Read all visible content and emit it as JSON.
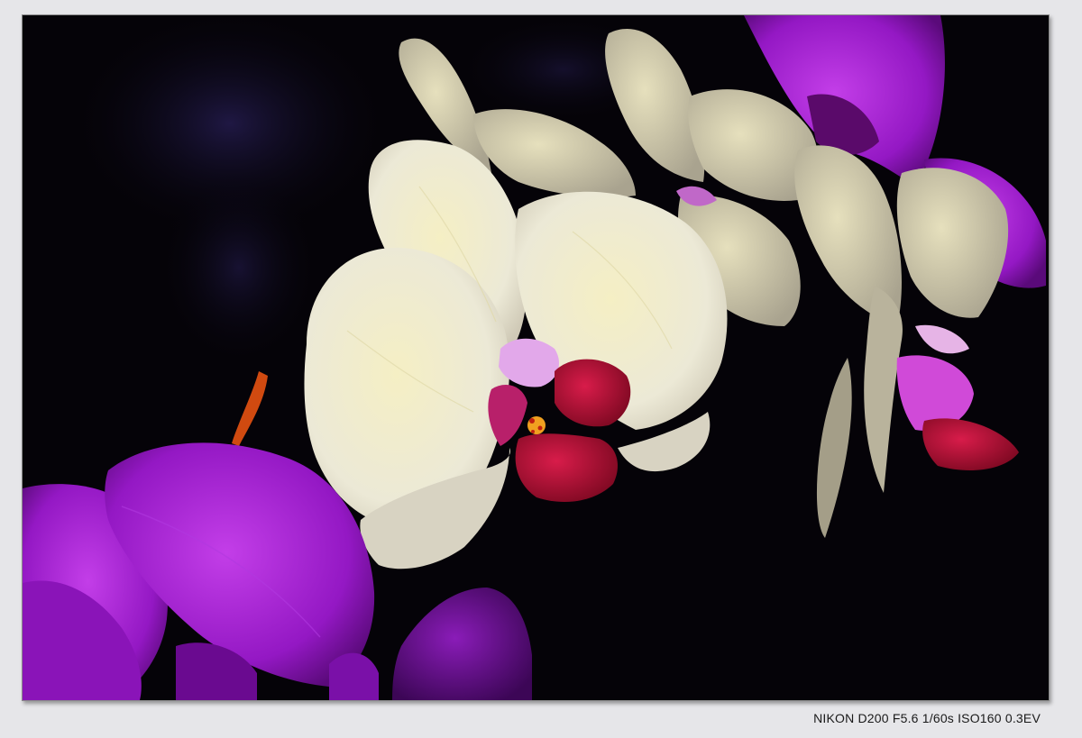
{
  "photo": {
    "caption": "NIKON D200 F5.6 1/60s ISO160 0.3EV",
    "colors": {
      "background": "#050308",
      "matte": "#e6e6e9",
      "white_petal": "#f2efc8",
      "magenta_petal": "#a020d0",
      "lip_red": "#b01030"
    }
  }
}
